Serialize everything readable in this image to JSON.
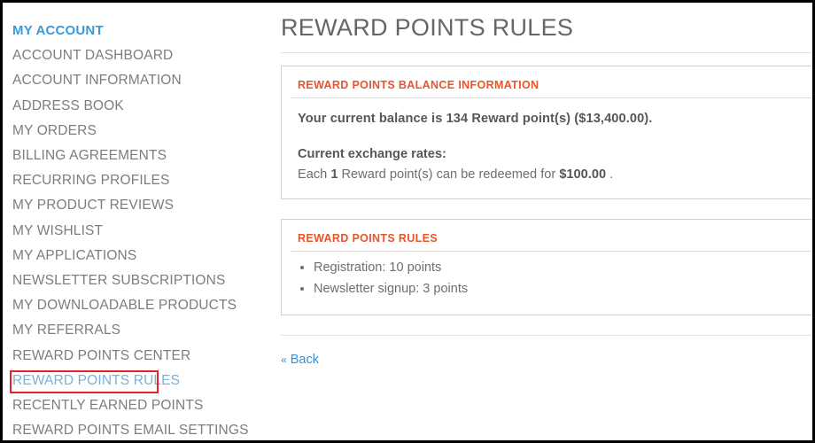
{
  "sidebar": {
    "items": [
      {
        "label": "MY ACCOUNT",
        "state": "section-head"
      },
      {
        "label": "ACCOUNT DASHBOARD",
        "state": "normal"
      },
      {
        "label": "ACCOUNT INFORMATION",
        "state": "normal"
      },
      {
        "label": "ADDRESS BOOK",
        "state": "normal"
      },
      {
        "label": "MY ORDERS",
        "state": "normal"
      },
      {
        "label": "BILLING AGREEMENTS",
        "state": "normal"
      },
      {
        "label": "RECURRING PROFILES",
        "state": "normal"
      },
      {
        "label": "MY PRODUCT REVIEWS",
        "state": "normal"
      },
      {
        "label": "MY WISHLIST",
        "state": "normal"
      },
      {
        "label": "MY APPLICATIONS",
        "state": "normal"
      },
      {
        "label": "NEWSLETTER SUBSCRIPTIONS",
        "state": "normal"
      },
      {
        "label": "MY DOWNLOADABLE PRODUCTS",
        "state": "normal"
      },
      {
        "label": "MY REFERRALS",
        "state": "normal"
      },
      {
        "label": "REWARD POINTS CENTER",
        "state": "normal"
      },
      {
        "label": "REWARD POINTS RULES",
        "state": "current"
      },
      {
        "label": "RECENTLY EARNED POINTS",
        "state": "normal"
      },
      {
        "label": "REWARD POINTS EMAIL SETTINGS",
        "state": "normal"
      }
    ]
  },
  "main": {
    "title": "REWARD POINTS RULES",
    "balance_panel": {
      "heading": "REWARD POINTS BALANCE INFORMATION",
      "balance_text": "Your current balance is 134 Reward point(s) ($13,400.00).",
      "balance_points": "134",
      "balance_currency": "$13,400.00",
      "rates_heading": "Current exchange rates:",
      "rate_prefix": "Each",
      "rate_points": "1",
      "rate_middle": "Reward point(s) can be redeemed for",
      "rate_amount": "$100.00",
      "rate_suffix": "."
    },
    "rules_panel": {
      "heading": "REWARD POINTS RULES",
      "rules": [
        "Registration: 10 points",
        "Newsletter signup: 3 points"
      ]
    },
    "back_link": {
      "chevron": "«",
      "label": "Back"
    }
  },
  "colors": {
    "accent_orange": "#e8552b",
    "link_blue": "#3a8fd0",
    "section_head_blue": "#3a99d8",
    "current_item_blue": "#7db0dc",
    "highlight_red": "#e8202a",
    "text_gray": "#7d7d7d",
    "body_text": "#53585c"
  }
}
